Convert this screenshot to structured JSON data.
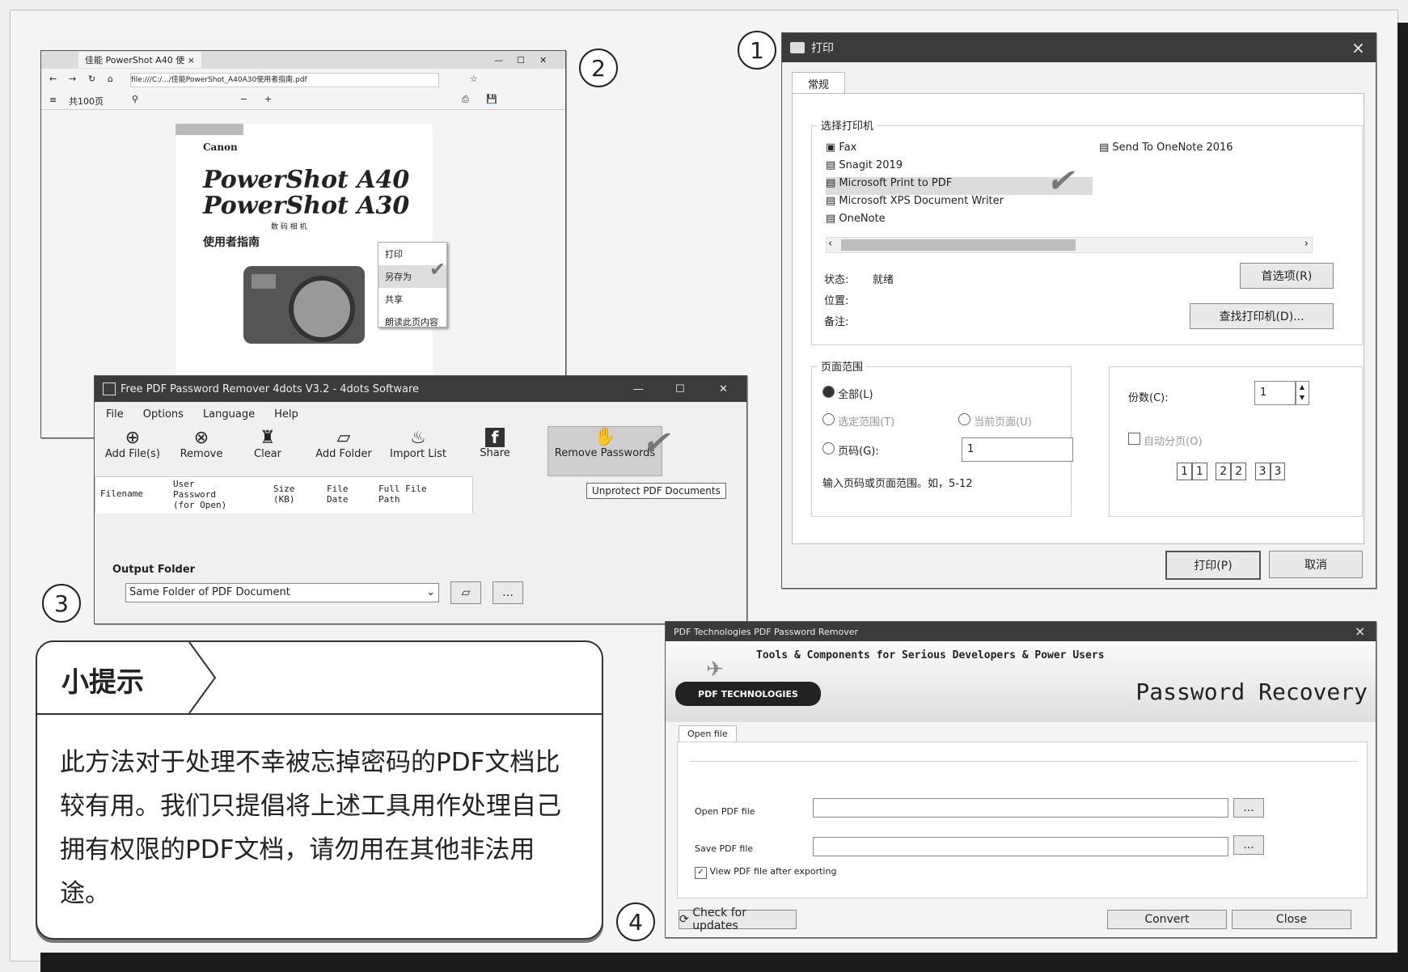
{
  "labels": {
    "n1": "1",
    "n2": "2",
    "n3": "3",
    "n4": "4"
  },
  "print_dialog": {
    "title": "打印",
    "close": "×",
    "tab": "常规",
    "group_printer": "选择打印机",
    "printers": [
      "Fax",
      "Snagit 2019",
      "Microsoft Print to PDF",
      "Microsoft XPS Document Writer",
      "OneNote"
    ],
    "printer_right": "Send To OneNote 2016",
    "status_label": "状态:",
    "status_value": "就绪",
    "location_label": "位置:",
    "comment_label": "备注:",
    "preferences_btn": "首选项(R)",
    "find_printer_btn": "查找打印机(D)...",
    "group_range": "页面范围",
    "range_all": "全部(L)",
    "range_selection": "选定范围(T)",
    "range_current": "当前页面(U)",
    "range_pages": "页码(G):",
    "pages_value": "1",
    "range_hint": "输入页码或页面范围。如，5-12",
    "copies_label": "份数(C):",
    "copies_value": "1",
    "collate": "自动分页(O)",
    "collate_icons": [
      "1",
      "1",
      "2",
      "2",
      "3",
      "3"
    ],
    "print_btn": "打印(P)",
    "cancel_btn": "取消"
  },
  "browser": {
    "tab_title": "佳能 PowerShot A40 使 ×",
    "address": "file:///C:/.../佳能PowerShot_A40A30使用者指南.pdf",
    "page_label": "共100页",
    "pdf_brand": "Canon",
    "pdf_title1": "PowerShot A40",
    "pdf_title2": "PowerShot A30",
    "pdf_small": "数 码 相 机",
    "pdf_subtitle": "使用者指南",
    "context_menu": [
      "打印",
      "另存为",
      "共享",
      "朗读此页内容"
    ]
  },
  "remover": {
    "title": "Free PDF Password Remover 4dots V3.2 - 4dots Software",
    "menu": [
      "File",
      "Options",
      "Language",
      "Help"
    ],
    "toolbar": [
      "Add File(s)",
      "Remove",
      "Clear",
      "Add Folder",
      "Import List",
      "Share",
      "Remove Passwords"
    ],
    "columns": [
      "Filename",
      "User Password (for Open)",
      "Size (KB)",
      "File Date",
      "Full File Path"
    ],
    "tooltip": "Unprotect PDF Documents",
    "output_label": "Output Folder",
    "output_value": "Same Folder of PDF Document"
  },
  "tip": {
    "heading": "小提示",
    "body": "此方法对于处理不幸被忘掉密码的PDF文档比较有用。我们只提倡将上述工具用作处理自己拥有权限的PDF文档，请勿用在其他非法用途。"
  },
  "recovery": {
    "title": "PDF Technologies PDF Password Remover",
    "close": "×",
    "tagline": "Tools & Components for Serious Developers & Power Users",
    "logo_text": "PDF TECHNOLOGIES",
    "banner_right": "Password Recovery",
    "tab": "Open file",
    "open_label": "Open PDF file",
    "save_label": "Save PDF file",
    "browse": "...",
    "view_after": "View PDF file after exporting",
    "check_updates": "Check for updates",
    "convert": "Convert",
    "close_btn": "Close"
  }
}
